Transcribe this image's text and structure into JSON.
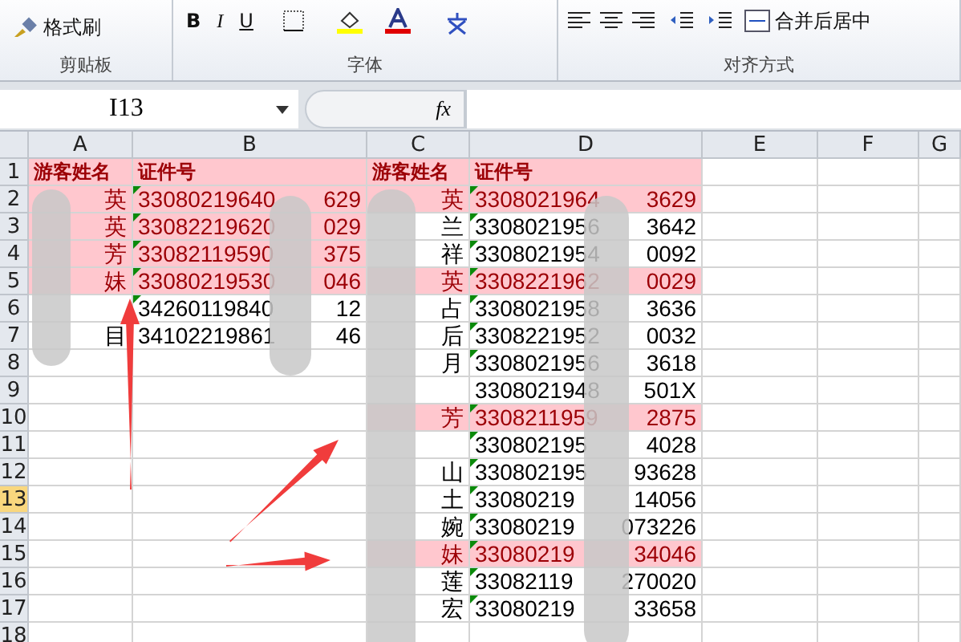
{
  "ribbon": {
    "clipboard": {
      "format_painter": "格式刷",
      "label": "剪贴板"
    },
    "font": {
      "bold": "B",
      "italic": "I",
      "underline": "U",
      "label": "字体"
    },
    "alignment": {
      "merge": "合并后居中",
      "label": "对齐方式"
    }
  },
  "formula_bar": {
    "name_box": "I13",
    "fx": "fx"
  },
  "columns": [
    {
      "label": "A",
      "selected": false
    },
    {
      "label": "B",
      "selected": false
    },
    {
      "label": "C",
      "selected": false
    },
    {
      "label": "D",
      "selected": false
    },
    {
      "label": "E",
      "selected": false
    },
    {
      "label": "F",
      "selected": false
    },
    {
      "label": "G",
      "selected": false
    }
  ],
  "rows": [
    {
      "number": "1",
      "selected": false,
      "left": {
        "name": {
          "kind": "header",
          "text": "游客姓名"
        },
        "id": {
          "kind": "header",
          "text": "证件号"
        },
        "highlight": true
      },
      "right": {
        "name": {
          "kind": "header",
          "text": "游客姓名"
        },
        "id": {
          "kind": "header",
          "text": "证件号"
        },
        "highlight": true
      }
    },
    {
      "number": "2",
      "selected": false,
      "left": {
        "name": {
          "kind": "name",
          "text": "英"
        },
        "id": {
          "kind": "id",
          "start": "33080219640",
          "end": "629",
          "flagged": true
        },
        "highlight": true
      },
      "right": {
        "name": {
          "kind": "name",
          "text": "英"
        },
        "id": {
          "kind": "id",
          "start": "3308021964",
          "end": "3629",
          "flagged": true
        },
        "highlight": true
      }
    },
    {
      "number": "3",
      "selected": false,
      "left": {
        "name": {
          "kind": "name",
          "text": "英"
        },
        "id": {
          "kind": "id",
          "start": "33082219620",
          "end": "029",
          "flagged": true
        },
        "highlight": true
      },
      "right": {
        "name": {
          "kind": "name",
          "text": "兰"
        },
        "id": {
          "kind": "id",
          "start": "3308021956",
          "end": "3642",
          "flagged": true
        },
        "highlight": false
      }
    },
    {
      "number": "4",
      "selected": false,
      "left": {
        "name": {
          "kind": "name",
          "text": "芳"
        },
        "id": {
          "kind": "id",
          "start": "33082119590",
          "end": "375",
          "flagged": true
        },
        "highlight": true
      },
      "right": {
        "name": {
          "kind": "name",
          "text": "祥"
        },
        "id": {
          "kind": "id",
          "start": "3308021954",
          "end": "0092",
          "flagged": true
        },
        "highlight": false
      }
    },
    {
      "number": "5",
      "selected": false,
      "left": {
        "name": {
          "kind": "name",
          "text": "妹"
        },
        "id": {
          "kind": "id",
          "start": "33080219530",
          "end": "046",
          "flagged": true
        },
        "highlight": true
      },
      "right": {
        "name": {
          "kind": "name",
          "text": "英"
        },
        "id": {
          "kind": "id",
          "start": "3308221962",
          "end": "0029",
          "flagged": true
        },
        "highlight": true
      }
    },
    {
      "number": "6",
      "selected": false,
      "left": {
        "id": {
          "kind": "id",
          "start": "34260119840",
          "end": "12",
          "flagged": true
        },
        "highlight": false
      },
      "right": {
        "name": {
          "kind": "name",
          "text": "占"
        },
        "id": {
          "kind": "id",
          "start": "3308021958",
          "end": "3636",
          "flagged": true
        },
        "highlight": false
      }
    },
    {
      "number": "7",
      "selected": false,
      "left": {
        "name": {
          "kind": "name",
          "text": "目"
        },
        "id": {
          "kind": "id",
          "start": "34102219861",
          "end": "46",
          "flagged": false
        },
        "highlight": false
      },
      "right": {
        "name": {
          "kind": "name",
          "text": "后"
        },
        "id": {
          "kind": "id",
          "start": "3308221952",
          "end": "0032",
          "flagged": true
        },
        "highlight": false
      }
    },
    {
      "number": "8",
      "selected": false,
      "right": {
        "name": {
          "kind": "name",
          "text": "月"
        },
        "id": {
          "kind": "id",
          "start": "3308021956",
          "end": "3618",
          "flagged": true
        },
        "highlight": false
      }
    },
    {
      "number": "9",
      "selected": false,
      "right": {
        "id": {
          "kind": "id",
          "start": "3308021948",
          "end": "501X",
          "flagged": false
        },
        "highlight": false
      }
    },
    {
      "number": "10",
      "selected": false,
      "right": {
        "name": {
          "kind": "name",
          "text": "芳"
        },
        "id": {
          "kind": "id",
          "start": "3308211959",
          "end": "2875",
          "flagged": true
        },
        "highlight": true
      }
    },
    {
      "number": "11",
      "selected": false,
      "right": {
        "id": {
          "kind": "id",
          "start": "330802195",
          "end": "4028",
          "flagged": true
        },
        "highlight": false
      }
    },
    {
      "number": "12",
      "selected": false,
      "right": {
        "name": {
          "kind": "name",
          "text": "山"
        },
        "id": {
          "kind": "id",
          "start": "330802195",
          "end": "93628",
          "flagged": true
        },
        "highlight": false
      }
    },
    {
      "number": "13",
      "selected": true,
      "right": {
        "name": {
          "kind": "name",
          "text": "土"
        },
        "id": {
          "kind": "id",
          "start": "33080219",
          "end": "14056",
          "flagged": true
        },
        "highlight": false
      }
    },
    {
      "number": "14",
      "selected": false,
      "right": {
        "name": {
          "kind": "name",
          "text": "婉"
        },
        "id": {
          "kind": "id",
          "start": "33080219",
          "end": "073226",
          "flagged": true
        },
        "highlight": false
      }
    },
    {
      "number": "15",
      "selected": false,
      "right": {
        "name": {
          "kind": "name",
          "text": "妹"
        },
        "id": {
          "kind": "id",
          "start": "33080219",
          "end": "34046",
          "flagged": true
        },
        "highlight": true
      }
    },
    {
      "number": "16",
      "selected": false,
      "right": {
        "name": {
          "kind": "name",
          "text": "莲"
        },
        "id": {
          "kind": "id",
          "start": "33082119",
          "end": "270020",
          "flagged": true
        },
        "highlight": false
      }
    },
    {
      "number": "17",
      "selected": false,
      "right": {
        "name": {
          "kind": "name",
          "text": "宏"
        },
        "id": {
          "kind": "id",
          "start": "33080219",
          "end": "33658",
          "flagged": true
        },
        "highlight": false
      }
    },
    {
      "number": "18",
      "selected": false
    }
  ]
}
